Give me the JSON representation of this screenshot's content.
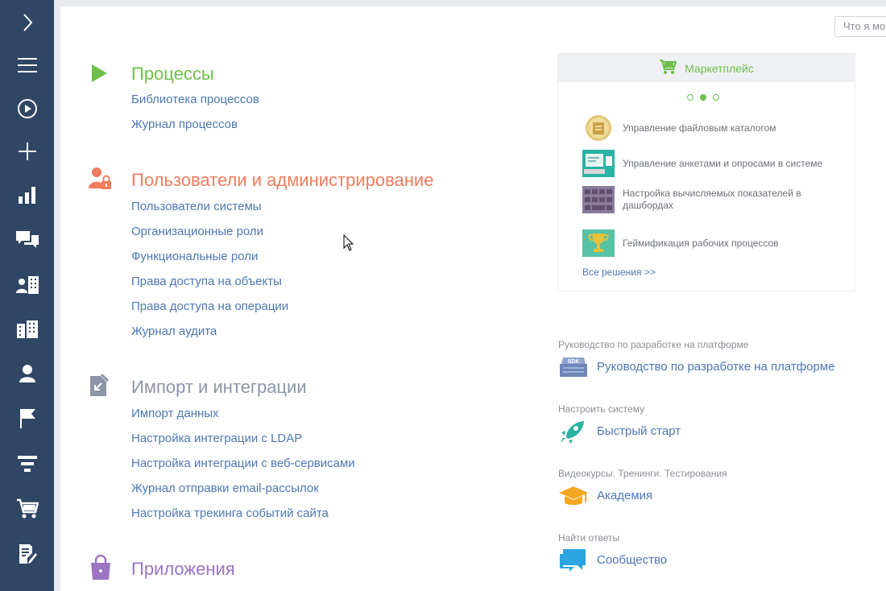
{
  "sidebar": {
    "items": [
      {
        "icon": "chevron-right-icon"
      },
      {
        "icon": "menu-icon"
      },
      {
        "icon": "play-circle-icon"
      },
      {
        "icon": "plus-icon"
      },
      {
        "icon": "bar-chart-icon"
      },
      {
        "icon": "chat-icon"
      },
      {
        "icon": "contacts-building-icon"
      },
      {
        "icon": "building-icon"
      },
      {
        "icon": "person-icon"
      },
      {
        "icon": "flag-icon"
      },
      {
        "icon": "funnel-icon"
      },
      {
        "icon": "cart-icon"
      },
      {
        "icon": "document-edit-icon"
      }
    ]
  },
  "search": {
    "placeholder": "Что я мо"
  },
  "sections": [
    {
      "title": "Процессы",
      "color": "#6fbf4a",
      "links": [
        "Библиотека процессов",
        "Журнал процессов"
      ]
    },
    {
      "title": "Пользователи и администрирование",
      "color": "#ef7c5c",
      "links": [
        "Пользователи системы",
        "Организационные роли",
        "Функциональные роли",
        "Права доступа на объекты",
        "Права доступа на операции",
        "Журнал аудита"
      ]
    },
    {
      "title": "Импорт и интеграции",
      "color": "#8c95a8",
      "links": [
        "Импорт данных",
        "Настройка интеграции с LDAP",
        "Настройка интеграции с веб-сервисами",
        "Журнал отправки email-рассылок",
        "Настройка трекинга событий сайта"
      ]
    },
    {
      "title": "Приложения",
      "color": "#9b73c2",
      "links": []
    }
  ],
  "marketplace": {
    "title": "Маркетплейс",
    "carousel_pages": 3,
    "active_page": 2,
    "items": [
      {
        "text": "Управление файловым каталогом",
        "icon": "file-catalog-icon"
      },
      {
        "text": "Управление анкетами и опросами в системе",
        "icon": "survey-icon"
      },
      {
        "text": "Настройка вычисляемых показателей в дашбордах",
        "icon": "keyboard-icon"
      },
      {
        "text": "Геймификация рабочих процессов",
        "icon": "trophy-icon"
      }
    ],
    "all_link": "Все решения >>"
  },
  "resources": [
    {
      "caption": "Руководство по разработке на платформе",
      "link": "Руководство по разработке на платформе",
      "icon": "sdk-icon"
    },
    {
      "caption": "Настроить систему",
      "link": "Быстрый старт",
      "icon": "rocket-icon"
    },
    {
      "caption": "Видеокурсы. Тренинги. Тестирования",
      "link": "Академия",
      "icon": "graduation-cap-icon"
    },
    {
      "caption": "Найти ответы",
      "link": "Сообщество",
      "icon": "community-chat-icon"
    }
  ],
  "colors": {
    "sidebar": "#2f4665",
    "link": "#4c78b4",
    "marketplace": "#6fbf4a"
  }
}
